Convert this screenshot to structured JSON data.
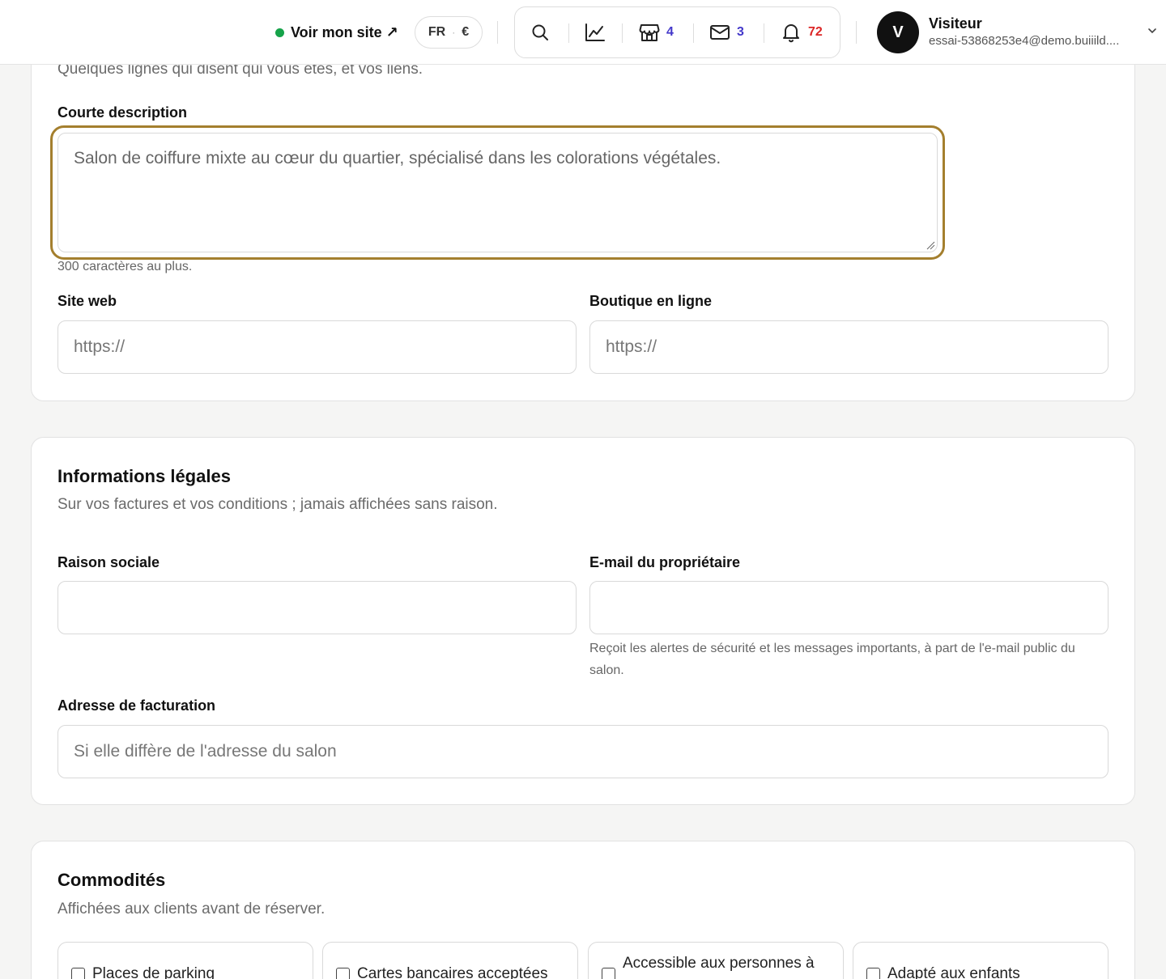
{
  "topbar": {
    "site_link_label": "Voir mon site ↗",
    "locale": {
      "language": "FR",
      "separator": "·",
      "currency": "€"
    },
    "tools": {
      "shop_count": "4",
      "mail_count": "3",
      "notification_count": "72"
    },
    "user": {
      "avatar_initial": "V",
      "name": "Visiteur",
      "email": "essai-53868253e4@demo.buiiild...."
    }
  },
  "profile_section": {
    "subtitle": "Quelques lignes qui disent qui vous êtes, et vos liens.",
    "short_description": {
      "label": "Courte description",
      "value": "Salon de coiffure mixte au cœur du quartier, spécialisé dans les colorations végétales.",
      "help": "300 caractères au plus."
    },
    "website": {
      "label": "Site web",
      "placeholder": "https://"
    },
    "shop": {
      "label": "Boutique en ligne",
      "placeholder": "https://"
    }
  },
  "legal_section": {
    "title": "Informations légales",
    "subtitle": "Sur vos factures et vos conditions ; jamais affichées sans raison.",
    "company_name": {
      "label": "Raison sociale",
      "value": ""
    },
    "owner_email": {
      "label": "E-mail du propriétaire",
      "value": "",
      "help": "Reçoit les alertes de sécurité et les messages importants, à part de l'e-mail public du salon."
    },
    "billing_address": {
      "label": "Adresse de facturation",
      "placeholder": "Si elle diffère de l'adresse du salon"
    }
  },
  "amenities_section": {
    "title": "Commodités",
    "subtitle": "Affichées aux clients avant de réserver.",
    "items": [
      {
        "label": "Places de parking",
        "checked": false
      },
      {
        "label": "Cartes bancaires acceptées",
        "checked": false
      },
      {
        "label": "Accessible aux personnes à",
        "checked": false
      },
      {
        "label": "Adapté aux enfants",
        "checked": false
      }
    ]
  },
  "colors": {
    "accent_focus": "#a47f2e",
    "status_online": "#16a34a",
    "count_blue": "#4338ca",
    "count_red": "#dc2626"
  }
}
